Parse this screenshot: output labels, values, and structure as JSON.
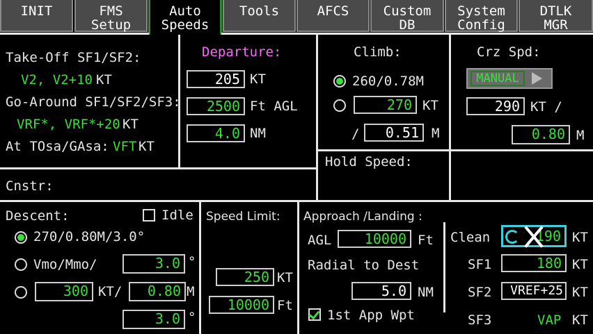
{
  "tabs": [
    {
      "l1": "INIT",
      "l2": ""
    },
    {
      "l1": "FMS",
      "l2": "Setup"
    },
    {
      "l1": "Auto",
      "l2": "Speeds"
    },
    {
      "l1": "Tools",
      "l2": ""
    },
    {
      "l1": "AFCS",
      "l2": ""
    },
    {
      "l1": "Custom",
      "l2": "DB"
    },
    {
      "l1": "System",
      "l2": "Config"
    },
    {
      "l1": "DTLK",
      "l2": "MGR"
    }
  ],
  "takeoff": {
    "sf_label": "Take-Off SF1/SF2:",
    "sf_value": "V2, V2+10",
    "sf_unit": "KT",
    "ga_label": "Go-Around SF1/SF2/SF3:",
    "ga_value": "VRF*, VRF*+20",
    "ga_unit": "KT",
    "tosa_label": "At TOsa/GAsa:",
    "tosa_value": "VFT",
    "tosa_unit": "KT"
  },
  "departure": {
    "title": "Departure:",
    "speed": "205",
    "speed_unit": "KT",
    "alt": "2500",
    "alt_unit": "Ft AGL",
    "dist": "4.0",
    "dist_unit": "NM"
  },
  "climb": {
    "title": "Climb:",
    "option1": "260/0.78M",
    "speed": "270",
    "speed_unit": "KT",
    "slash": "/",
    "mach": "0.51",
    "mach_unit": "M"
  },
  "cruise": {
    "title": "Crz Spd:",
    "mode": "MANUAL",
    "speed": "290",
    "speed_unit": "KT /",
    "mach": "0.80",
    "mach_unit": "M"
  },
  "hold": {
    "title": "Hold Speed:"
  },
  "cnstr": {
    "label": "Cnstr:"
  },
  "descent": {
    "title": "Descent:",
    "idle": "Idle",
    "option1": "270/0.80M/3.0°",
    "option2": "Vmo/Mmo/",
    "angle2": "3.0",
    "deg": "°",
    "speed3": "300",
    "kt3": "KT/",
    "mach3": "0.80",
    "m3": "M",
    "angle3": "3.0"
  },
  "speedlimit": {
    "title": "Speed Limit:",
    "speed": "250",
    "speed_unit": "KT",
    "alt": "10000",
    "alt_unit": "Ft"
  },
  "approach": {
    "title": "Approach /Landing :",
    "agl_label": "AGL",
    "agl": "10000",
    "agl_unit": "Ft",
    "radial": "Radial to Dest",
    "dist": "5.0",
    "dist_unit": "NM",
    "first_wpt": "1st App Wpt",
    "clean_label": "Clean",
    "clean": "190",
    "clean_unit": "KT",
    "sf1_label": "SF1",
    "sf1": "180",
    "sf1_unit": "KT",
    "sf2_label": "SF2",
    "sf2": "VREF+25",
    "sf2_unit": "KT",
    "sf3_label": "SF3",
    "sf3": "VAP",
    "sf3_unit": "KT"
  }
}
